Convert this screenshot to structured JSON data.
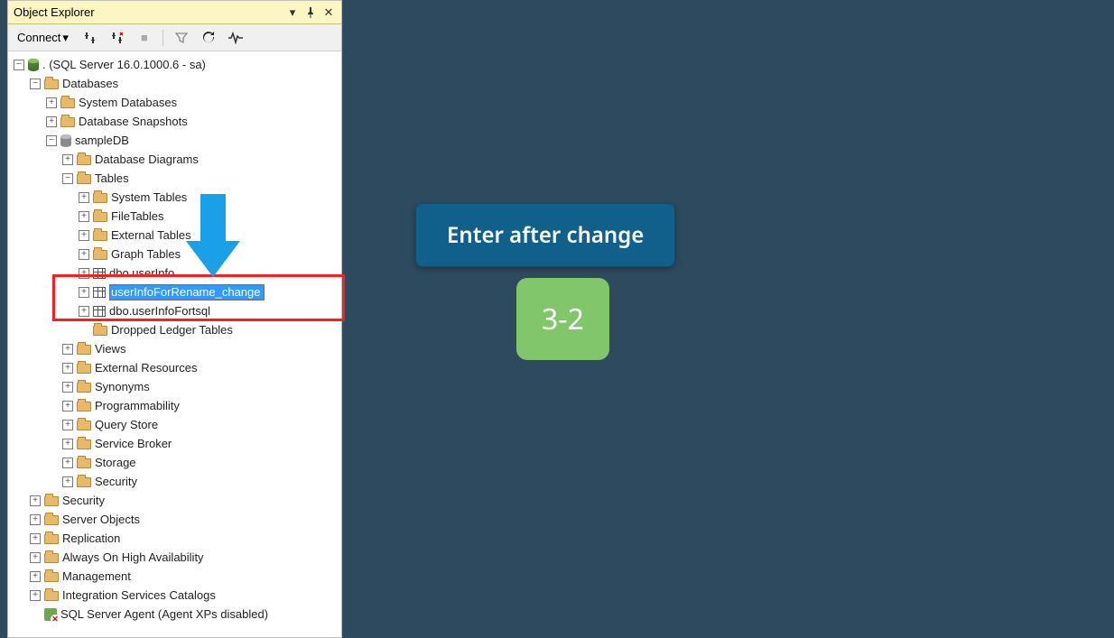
{
  "panel": {
    "title": "Object Explorer"
  },
  "toolbar": {
    "connect_label": "Connect",
    "dropdown_glyph": "▾"
  },
  "tree": {
    "server": ". (SQL Server 16.0.1000.6 - sa)",
    "databases": "Databases",
    "system_databases": "System Databases",
    "database_snapshots": "Database Snapshots",
    "sampledb": "sampleDB",
    "database_diagrams": "Database Diagrams",
    "tables": "Tables",
    "system_tables": "System Tables",
    "filetables": "FileTables",
    "external_tables": "External Tables",
    "graph_tables": "Graph Tables",
    "dbo_userinfo": "dbo.userInfo",
    "rename_value": "userInfoForRename_change",
    "dbo_userinfofortsql": "dbo.userInfoFortsql",
    "dropped_ledger_tables": "Dropped Ledger Tables",
    "views": "Views",
    "external_resources": "External Resources",
    "synonyms": "Synonyms",
    "programmability": "Programmability",
    "query_store": "Query Store",
    "service_broker": "Service Broker",
    "storage": "Storage",
    "security_db": "Security",
    "security": "Security",
    "server_objects": "Server Objects",
    "replication": "Replication",
    "always_on": "Always On High Availability",
    "management": "Management",
    "integration_services": "Integration Services Catalogs",
    "sql_server_agent": "SQL Server Agent (Agent XPs disabled)"
  },
  "annotations": {
    "callout_text": "Enter after change",
    "step_label": "3-2"
  },
  "colors": {
    "highlight": "#ff1e1e",
    "arrow": "#1aa0e6",
    "callout_bg": "#10608b",
    "badge_bg": "#82c66b",
    "background": "#2e4a5f"
  }
}
